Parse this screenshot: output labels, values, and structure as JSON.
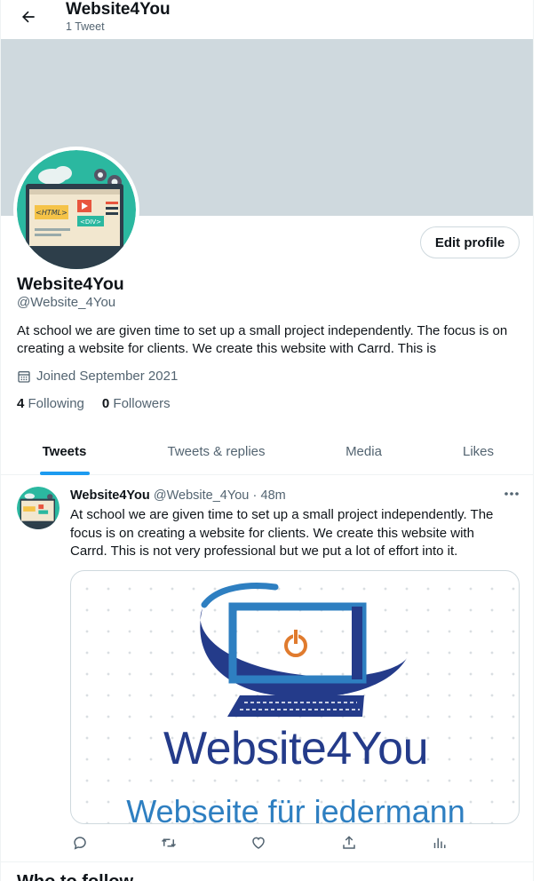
{
  "header": {
    "title": "Website4You",
    "subtitle": "1 Tweet",
    "back_icon": "arrow-left-icon"
  },
  "profile": {
    "name": "Website4You",
    "handle": "@Website_4You",
    "bio": "At school we are given time to set up a small project independently. The focus is on creating a website for clients. We create this website with Carrd. This is",
    "joined": "Joined September 2021",
    "following_count": "4",
    "following_label": "Following",
    "followers_count": "0",
    "followers_label": "Followers",
    "edit_button": "Edit profile",
    "banner_color": "#cfd9de"
  },
  "tabs": [
    {
      "label": "Tweets",
      "active": true
    },
    {
      "label": "Tweets & replies",
      "active": false
    },
    {
      "label": "Media",
      "active": false
    },
    {
      "label": "Likes",
      "active": false
    }
  ],
  "tweet": {
    "name": "Website4You",
    "handle": "@Website_4You",
    "separator": "·",
    "time": "48m",
    "text": "At school we are given time to set up a small project independently. The focus is on creating a website for clients. We create this website with Carrd. This is not very professional but we put a lot of effort into it.",
    "media": {
      "title": "Website4You",
      "subtitle": "Webseite für jedermann"
    },
    "actions": [
      "reply-icon",
      "retweet-icon",
      "like-icon",
      "share-icon",
      "analytics-icon"
    ]
  },
  "sidebar_next": {
    "heading": "Who to follow"
  },
  "colors": {
    "accent": "#1d9bf0",
    "text": "#0f1419",
    "muted": "#536471",
    "logo_blue": "#243b8a",
    "logo_light_blue": "#2e7fc1",
    "power_orange": "#e07b2e"
  }
}
